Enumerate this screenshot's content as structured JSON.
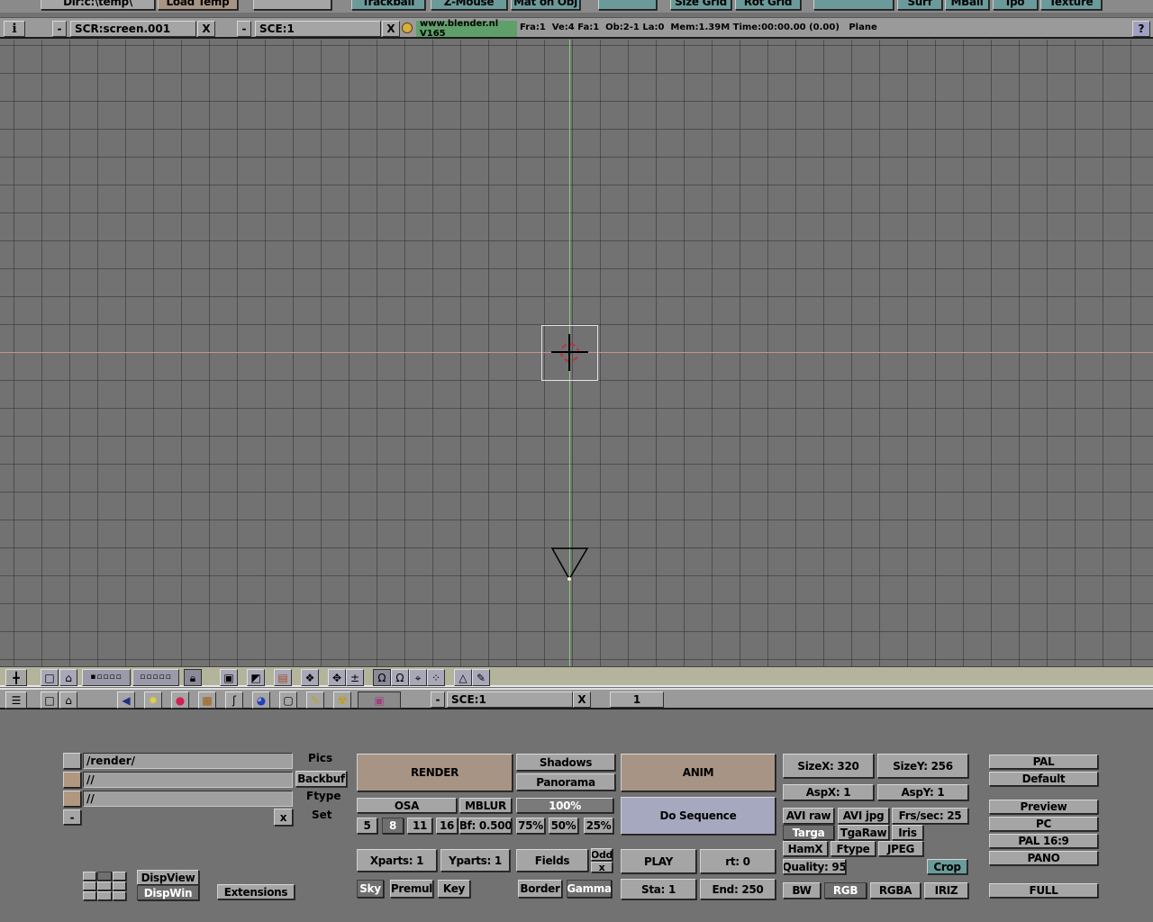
{
  "top_bar": {
    "items": [
      {
        "label": "Dir:c:\\temp\\",
        "style": "gray"
      },
      {
        "label": "Load Temp",
        "style": "tan"
      },
      {
        "label": "",
        "style": "gray"
      },
      {
        "label": "Trackball",
        "style": "teal"
      },
      {
        "label": "Z-Mouse",
        "style": "teal"
      },
      {
        "label": "Mat on Obj",
        "style": "teal"
      },
      {
        "label": "",
        "style": "teal"
      },
      {
        "label": "Size Grid",
        "style": "teal"
      },
      {
        "label": "Rot Grid",
        "style": "teal"
      },
      {
        "label": "",
        "style": "teal"
      },
      {
        "label": "Surf",
        "style": "teal"
      },
      {
        "label": "MBall",
        "style": "teal"
      },
      {
        "label": "Ipo",
        "style": "teal"
      },
      {
        "label": "Texture",
        "style": "teal"
      }
    ]
  },
  "info_header": {
    "screen_name": "SCR:screen.001",
    "scene_name": "SCE:1",
    "close_glyph": "X",
    "minus_glyph": "-",
    "version": "www.blender.nl V165",
    "stats": "Fra:1  Ve:4 Fa:1  Ob:2-1 La:0  Mem:1.39M Time:00:00.00 (0.00)   Plane",
    "help_glyph": "?"
  },
  "viewport": {
    "icons": [
      "grid-view",
      "3d-cursor",
      "camera",
      "selected-plane"
    ]
  },
  "buttons_header": {
    "scene_name": "SCE:1",
    "close_glyph": "X",
    "frame": "1"
  },
  "render": {
    "paths": {
      "pics": {
        "value": "/render/",
        "label": "Pics"
      },
      "backbuf": {
        "value": "//",
        "label": "Backbuf"
      },
      "ftype": {
        "value": "//",
        "label": "Ftype"
      },
      "set_label": "Set",
      "minus_glyph": "-",
      "x_glyph": "x"
    },
    "render_button": "RENDER",
    "shadows": "Shadows",
    "panorama": "Panorama",
    "osa": "OSA",
    "mblur": "MBLUR",
    "osa_levels": [
      "5",
      "8",
      "11",
      "16"
    ],
    "osa_selected": "8",
    "bf": "Bf: 0.500",
    "size_pct": [
      "100%",
      "75%",
      "50%",
      "25%"
    ],
    "size_selected": "100%",
    "xparts": "Xparts: 1",
    "yparts": "Yparts: 1",
    "fields": "Fields",
    "odd": "Odd",
    "odd_x": "x",
    "sky": "Sky",
    "premul": "Premul",
    "key": "Key",
    "border": "Border",
    "gamma": "Gamma",
    "dispview": "DispView",
    "dispwin": "DispWin",
    "extensions": "Extensions",
    "anim_button": "ANIM",
    "do_sequence": "Do Sequence",
    "play": "PLAY",
    "rt": "rt: 0",
    "sta": "Sta: 1",
    "end": "End: 250",
    "sizex": "SizeX: 320",
    "sizey": "SizeY: 256",
    "aspx": "AspX: 1",
    "aspy": "AspY: 1",
    "formats_row1": [
      "AVI raw",
      "AVI jpg",
      "Frs/sec: 25"
    ],
    "formats_row2": [
      "Targa",
      "TgaRaw",
      "Iris"
    ],
    "formats_row3": [
      "HamX",
      "Ftype",
      "JPEG"
    ],
    "format_selected": "Targa",
    "quality": "Quality: 95",
    "crop": "Crop",
    "color_modes": [
      "BW",
      "RGB",
      "RGBA",
      "IRIZ"
    ],
    "color_selected": "RGB",
    "presets": [
      "PAL",
      "Default",
      "Preview",
      "PC",
      "PAL 16:9",
      "PANO",
      "FULL"
    ]
  }
}
